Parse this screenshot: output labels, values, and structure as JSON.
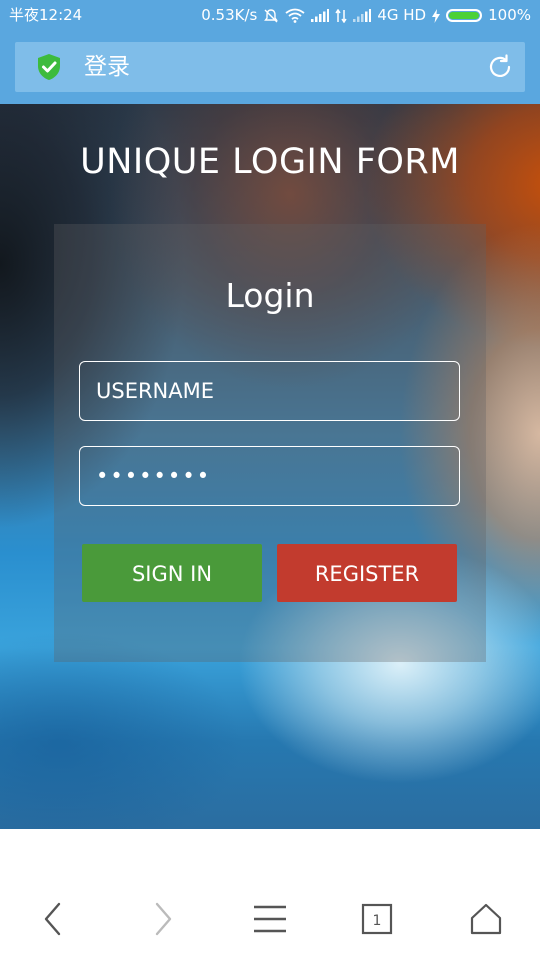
{
  "status_bar": {
    "time": "半夜12:24",
    "speed": "0.53K/s",
    "network": "4G HD",
    "battery": "100%"
  },
  "address_bar": {
    "title": "登录"
  },
  "page": {
    "heading": "UNIQUE LOGIN FORM",
    "login_title": "Login",
    "username_placeholder": "USERNAME",
    "password_value": "********",
    "sign_in_label": "SIGN IN",
    "register_label": "REGISTER"
  },
  "bottom_nav": {
    "tab_count": "1"
  },
  "colors": {
    "status_bar_bg": "#5aa7df",
    "sign_in_button": "#4a9a3a",
    "register_button": "#c23b2e",
    "secure_shield": "#3dbb3d"
  },
  "icons": [
    "shield-check-icon",
    "refresh-icon",
    "back-icon",
    "forward-icon",
    "menu-icon",
    "tabs-icon",
    "home-icon"
  ]
}
